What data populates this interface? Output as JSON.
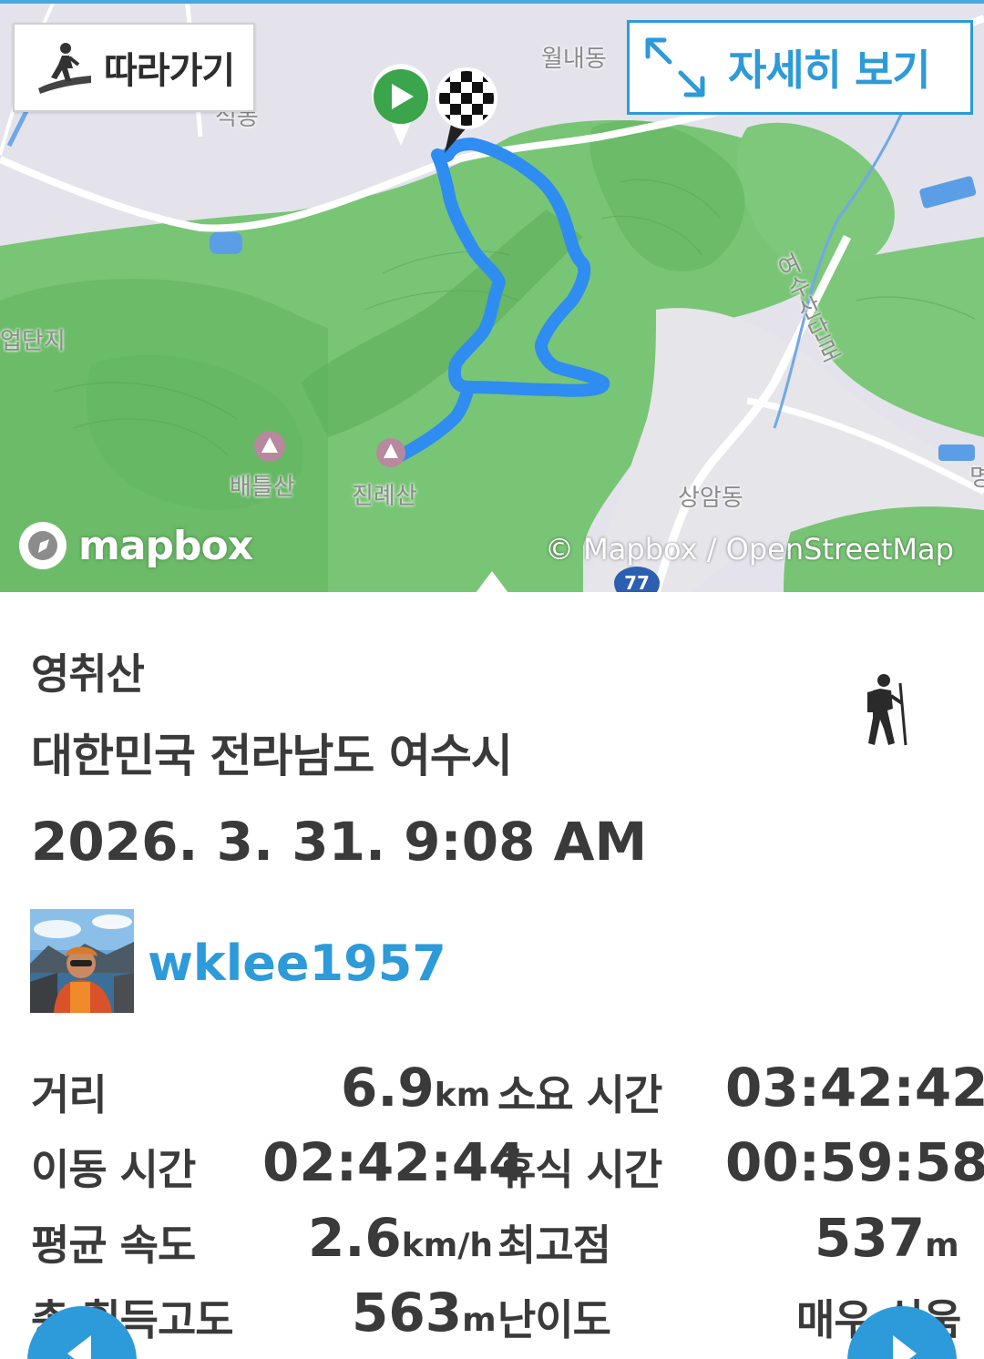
{
  "map": {
    "follow_button": "따라가기",
    "detail_button": "자세히 보기",
    "labels": {
      "wollae_dong": "월내동",
      "seok_dong": "석동",
      "industrial": "업단지",
      "baedeul_san": "배틀산",
      "jinrye_san": "진례산",
      "sangam_dong": "상암동",
      "road": "여수산단로",
      "edge": "명"
    },
    "mapbox_logo": "mapbox",
    "attribution": "© Mapbox / OpenStreetMap",
    "route_number": "77"
  },
  "track": {
    "name": "영취산",
    "location": "대한민국 전라남도 여수시",
    "datetime": "2026. 3. 31. 9:08 AM",
    "activity_icon": "hiker-icon"
  },
  "user": {
    "username": "wklee1957"
  },
  "stats": {
    "distance_label": "거리",
    "distance_value": "6.9",
    "distance_unit": "km",
    "duration_label": "소요 시간",
    "duration_value": "03:42:42",
    "moving_label": "이동 시간",
    "moving_value": "02:42:44",
    "rest_label": "휴식 시간",
    "rest_value": "00:59:58",
    "avg_speed_label": "평균 속도",
    "avg_speed_value": "2.6",
    "avg_speed_unit": "km/h",
    "max_alt_label": "최고점",
    "max_alt_value": "537",
    "max_alt_unit": "m",
    "gain_label": "총 획득고도",
    "gain_value": "563",
    "gain_unit": "m",
    "difficulty_label": "난이도",
    "difficulty_value": "매우 쉬움"
  },
  "colors": {
    "accent": "#2d9ad9",
    "route": "#2f8cf0",
    "forest": "#6fbf6f",
    "text": "#3a3a3a"
  }
}
